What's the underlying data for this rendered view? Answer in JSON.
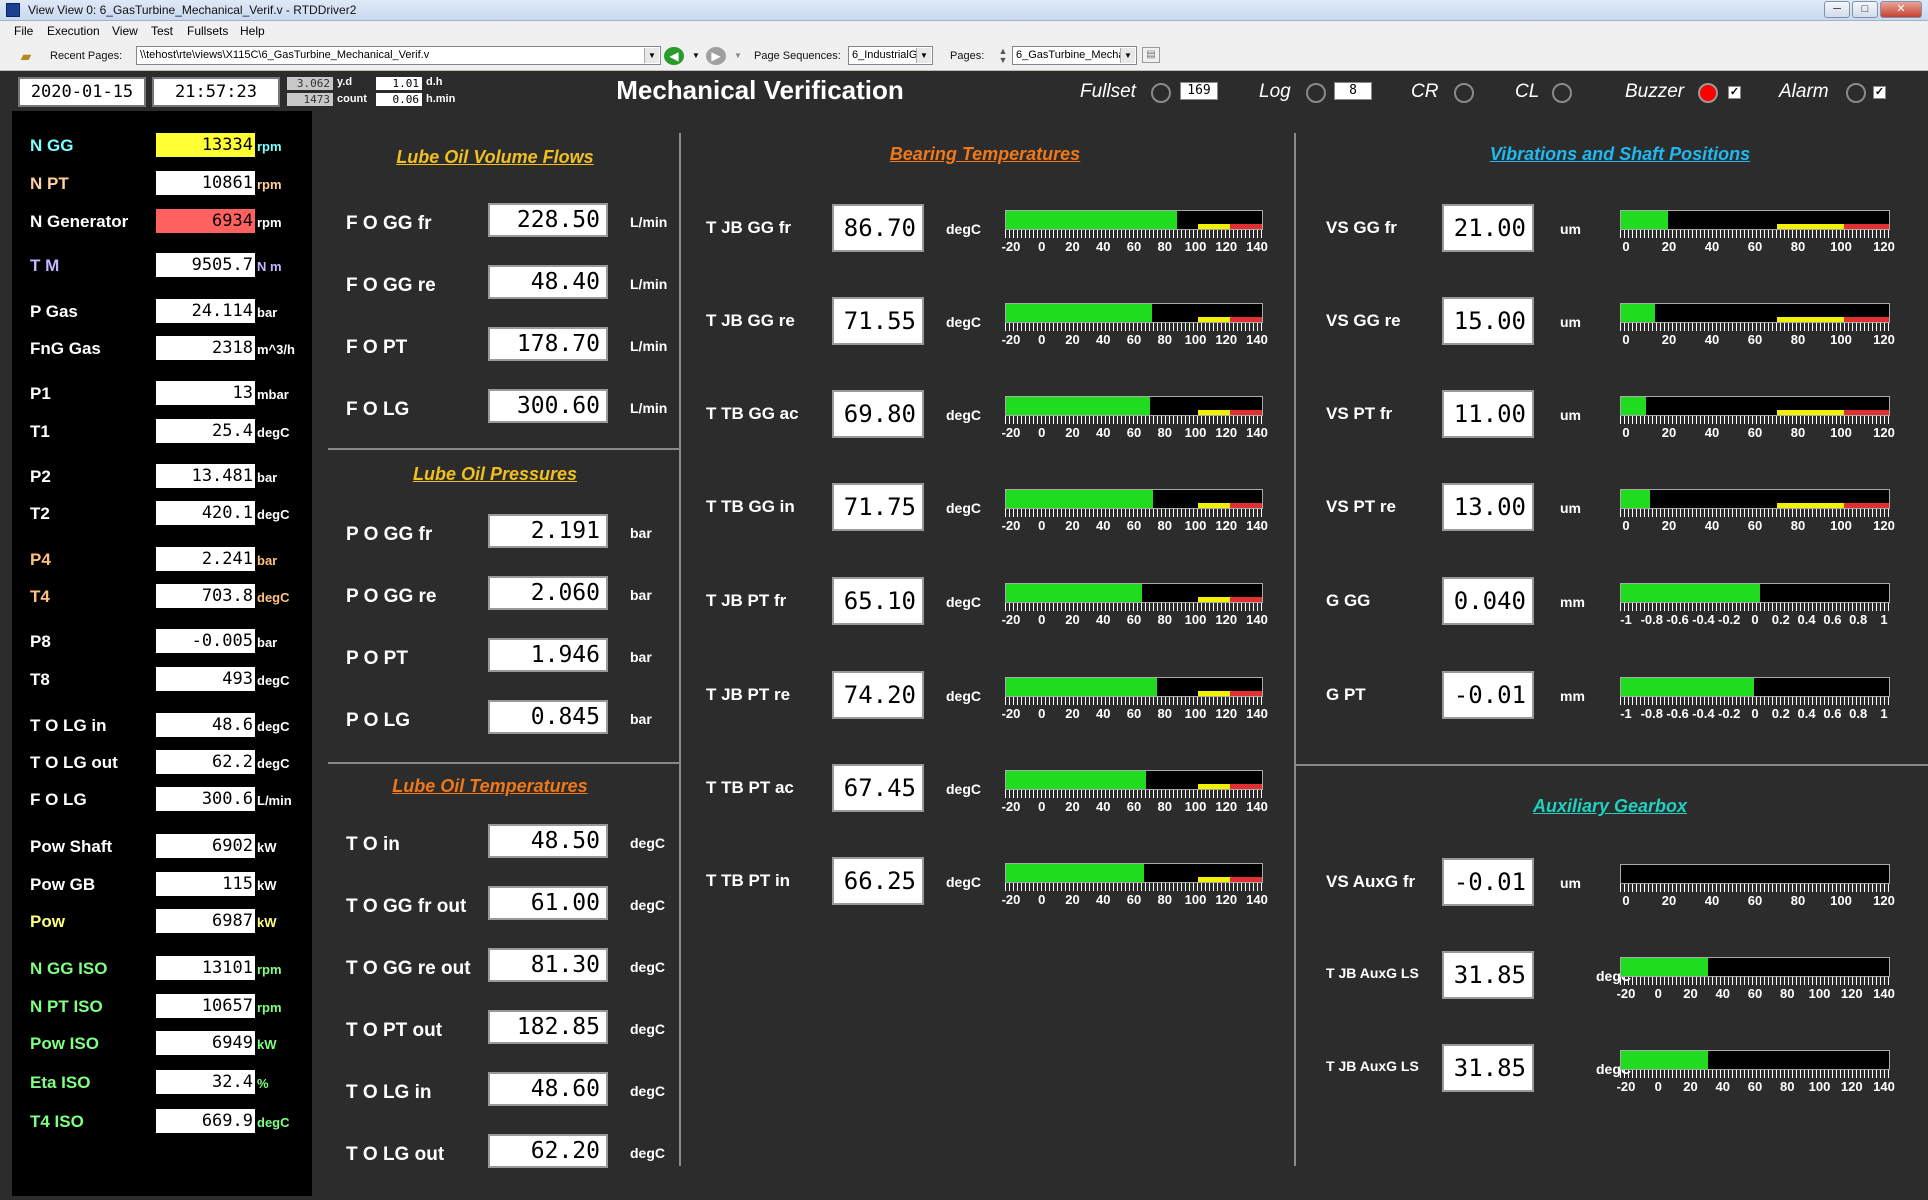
{
  "window": {
    "title": "View View 0: 6_GasTurbine_Mechanical_Verif.v - RTDDriver2"
  },
  "menu": [
    "File",
    "Execution",
    "View",
    "Test",
    "Fullsets",
    "Help"
  ],
  "toolbar": {
    "recent_label": "Recent Pages:",
    "recent_value": "\\\\tehost\\rte\\views\\X115C\\6_GasTurbine_Mechanical_Verif.v",
    "seq_label": "Page Sequences:",
    "seq_value": "6_IndustrialG",
    "pages_label": "Pages:",
    "pages_value": "6_GasTurbine_Mecha"
  },
  "header": {
    "date": "2020-01-15",
    "time": "21:57:23",
    "yd": "3.062",
    "yd_unit": "y.d",
    "dh": "1.01",
    "dh_unit": "d.h",
    "count": "1473",
    "count_unit": "count",
    "hmin": "0.06",
    "hmin_unit": "h.min",
    "title": "Mechanical Verification",
    "fullset_label": "Fullset",
    "fullset_count": "169",
    "log_label": "Log",
    "log_count": "8",
    "cr_label": "CR",
    "cl_label": "CL",
    "buzzer_label": "Buzzer",
    "buzzer_checked": "✓",
    "alarm_label": "Alarm",
    "alarm_checked": "✓"
  },
  "left": [
    {
      "name": "N GG",
      "value": "13334",
      "unit": "rpm",
      "color": "#7fffff",
      "bg": "#ffff33"
    },
    {
      "name": "N PT",
      "value": "10861",
      "unit": "rpm",
      "color": "#ffd0a0",
      "bg": "#ffffff"
    },
    {
      "name": "N Generator",
      "value": "6934",
      "unit": "rpm",
      "color": "#ffffff",
      "bg": "#ff6060"
    },
    {
      "name": "T M",
      "value": "9505.7",
      "unit": "N m",
      "color": "#c0b8ff",
      "bg": "#ffffff"
    },
    {
      "name": "P Gas",
      "value": "24.114",
      "unit": "bar",
      "color": "#ffffff",
      "bg": "#ffffff"
    },
    {
      "name": "FnG Gas",
      "value": "2318",
      "unit": "m^3/h",
      "color": "#ffffff",
      "bg": "#ffffff"
    },
    {
      "name": "P1",
      "value": "13",
      "unit": "mbar",
      "color": "#ffffff",
      "bg": "#ffffff"
    },
    {
      "name": "T1",
      "value": "25.4",
      "unit": "degC",
      "color": "#ffffff",
      "bg": "#ffffff"
    },
    {
      "name": "P2",
      "value": "13.481",
      "unit": "bar",
      "color": "#ffffff",
      "bg": "#ffffff"
    },
    {
      "name": "T2",
      "value": "420.1",
      "unit": "degC",
      "color": "#ffffff",
      "bg": "#ffffff"
    },
    {
      "name": "P4",
      "value": "2.241",
      "unit": "bar",
      "color": "#ffc080",
      "bg": "#ffffff"
    },
    {
      "name": "T4",
      "value": "703.8",
      "unit": "degC",
      "color": "#ffc080",
      "bg": "#ffffff"
    },
    {
      "name": "P8",
      "value": "-0.005",
      "unit": "bar",
      "color": "#ffffff",
      "bg": "#ffffff"
    },
    {
      "name": "T8",
      "value": "493",
      "unit": "degC",
      "color": "#ffffff",
      "bg": "#ffffff"
    },
    {
      "name": "T O LG in",
      "value": "48.6",
      "unit": "degC",
      "color": "#ffffff",
      "bg": "#ffffff"
    },
    {
      "name": "T O LG out",
      "value": "62.2",
      "unit": "degC",
      "color": "#ffffff",
      "bg": "#ffffff"
    },
    {
      "name": "F O LG",
      "value": "300.6",
      "unit": "L/min",
      "color": "#ffffff",
      "bg": "#ffffff"
    },
    {
      "name": "Pow Shaft",
      "value": "6902",
      "unit": "kW",
      "color": "#ffffff",
      "bg": "#ffffff"
    },
    {
      "name": "Pow GB",
      "value": "115",
      "unit": "kW",
      "color": "#ffffff",
      "bg": "#ffffff"
    },
    {
      "name": "Pow",
      "value": "6987",
      "unit": "kW",
      "color": "#ffff80",
      "bg": "#ffffff"
    },
    {
      "name": "N GG ISO",
      "value": "13101",
      "unit": "rpm",
      "color": "#80ff80",
      "bg": "#ffffff"
    },
    {
      "name": "N PT ISO",
      "value": "10657",
      "unit": "rpm",
      "color": "#80ff80",
      "bg": "#ffffff"
    },
    {
      "name": "Pow ISO",
      "value": "6949",
      "unit": "kW",
      "color": "#80ff80",
      "bg": "#ffffff"
    },
    {
      "name": "Eta ISO",
      "value": "32.4",
      "unit": "%",
      "color": "#80ff80",
      "bg": "#ffffff"
    },
    {
      "name": "T4 ISO",
      "value": "669.9",
      "unit": "degC",
      "color": "#80ff80",
      "bg": "#ffffff"
    }
  ],
  "flows": {
    "title": "Lube Oil Volume Flows",
    "rows": [
      {
        "name": "F O GG fr",
        "value": "228.50",
        "unit": "L/min"
      },
      {
        "name": "F O GG re",
        "value": "48.40",
        "unit": "L/min"
      },
      {
        "name": "F O PT",
        "value": "178.70",
        "unit": "L/min"
      },
      {
        "name": "F O LG",
        "value": "300.60",
        "unit": "L/min"
      }
    ]
  },
  "pressures": {
    "title": "Lube Oil Pressures",
    "rows": [
      {
        "name": "P O GG fr",
        "value": "2.191",
        "unit": "bar"
      },
      {
        "name": "P O GG re",
        "value": "2.060",
        "unit": "bar"
      },
      {
        "name": "P O PT",
        "value": "1.946",
        "unit": "bar"
      },
      {
        "name": "P O LG",
        "value": "0.845",
        "unit": "bar"
      }
    ]
  },
  "temps": {
    "title": "Lube Oil Temperatures",
    "rows": [
      {
        "name": "T O in",
        "value": "48.50",
        "unit": "degC"
      },
      {
        "name": "T O GG fr out",
        "value": "61.00",
        "unit": "degC"
      },
      {
        "name": "T O GG re out",
        "value": "81.30",
        "unit": "degC"
      },
      {
        "name": "T O PT out",
        "value": "182.85",
        "unit": "degC"
      },
      {
        "name": "T O LG in",
        "value": "48.60",
        "unit": "degC"
      },
      {
        "name": "T O LG out",
        "value": "62.20",
        "unit": "degC"
      }
    ]
  },
  "colors": {
    "section_yellow": "#f0c020",
    "section_orange": "#f07818",
    "section_cyan": "#20b8f0",
    "section_teal": "#20d0c0",
    "bar_green": "#1fdc1f",
    "bar_warn": "#f2f200",
    "bar_alarm": "#e03030"
  },
  "bearing": {
    "title": "Bearing Temperatures",
    "scale": {
      "min": -20,
      "max": 140,
      "labels": [
        "-20",
        "0",
        "20",
        "40",
        "60",
        "80",
        "100",
        "120",
        "140"
      ],
      "warn": [
        100,
        120
      ],
      "alarm": [
        120,
        140
      ]
    },
    "rows": [
      {
        "name": "T JB GG fr",
        "value": "86.70",
        "unit": "degC",
        "level": 86.7
      },
      {
        "name": "T JB GG re",
        "value": "71.55",
        "unit": "degC",
        "level": 71.55
      },
      {
        "name": "T TB GG ac",
        "value": "69.80",
        "unit": "degC",
        "level": 69.8
      },
      {
        "name": "T TB GG in",
        "value": "71.75",
        "unit": "degC",
        "level": 71.75
      },
      {
        "name": "T JB PT fr",
        "value": "65.10",
        "unit": "degC",
        "level": 65.1
      },
      {
        "name": "T JB PT re",
        "value": "74.20",
        "unit": "degC",
        "level": 74.2
      },
      {
        "name": "T TB PT ac",
        "value": "67.45",
        "unit": "degC",
        "level": 67.45
      },
      {
        "name": "T TB PT in",
        "value": "66.25",
        "unit": "degC",
        "level": 66.25
      }
    ]
  },
  "vibrations": {
    "title": "Vibrations and Shaft Positions",
    "vib_scale": {
      "min": 0,
      "max": 120,
      "labels": [
        "0",
        "20",
        "40",
        "60",
        "80",
        "100",
        "120"
      ],
      "warn": [
        70,
        100
      ],
      "alarm": [
        100,
        120
      ]
    },
    "pos_scale": {
      "min": -1,
      "max": 1,
      "labels": [
        "-1",
        "-0.8",
        "-0.6",
        "-0.4",
        "-0.2",
        "0",
        "0.2",
        "0.4",
        "0.6",
        "0.8",
        "1"
      ]
    },
    "rows": [
      {
        "name": "VS GG fr",
        "value": "21.00",
        "unit": "um",
        "level": 21,
        "scale": "vib"
      },
      {
        "name": "VS GG re",
        "value": "15.00",
        "unit": "um",
        "level": 15,
        "scale": "vib"
      },
      {
        "name": "VS PT fr",
        "value": "11.00",
        "unit": "um",
        "level": 11,
        "scale": "vib"
      },
      {
        "name": "VS PT re",
        "value": "13.00",
        "unit": "um",
        "level": 13,
        "scale": "vib"
      },
      {
        "name": "G GG",
        "value": "0.040",
        "unit": "mm",
        "level": 0.04,
        "scale": "pos"
      },
      {
        "name": "G PT",
        "value": "-0.01",
        "unit": "mm",
        "level": -0.01,
        "scale": "pos"
      }
    ]
  },
  "gearbox": {
    "title": "Auxiliary Gearbox",
    "rows": [
      {
        "name": "VS AuxG fr",
        "value": "-0.01",
        "unit": "um",
        "level": 0,
        "scale": "vib"
      },
      {
        "name": "T JB AuxG LS",
        "value": "31.85",
        "unit": "degC",
        "level": 31.85,
        "scale": "temp"
      },
      {
        "name": "T JB AuxG LS",
        "value": "31.85",
        "unit": "degC",
        "level": 31.85,
        "scale": "temp"
      }
    ]
  }
}
